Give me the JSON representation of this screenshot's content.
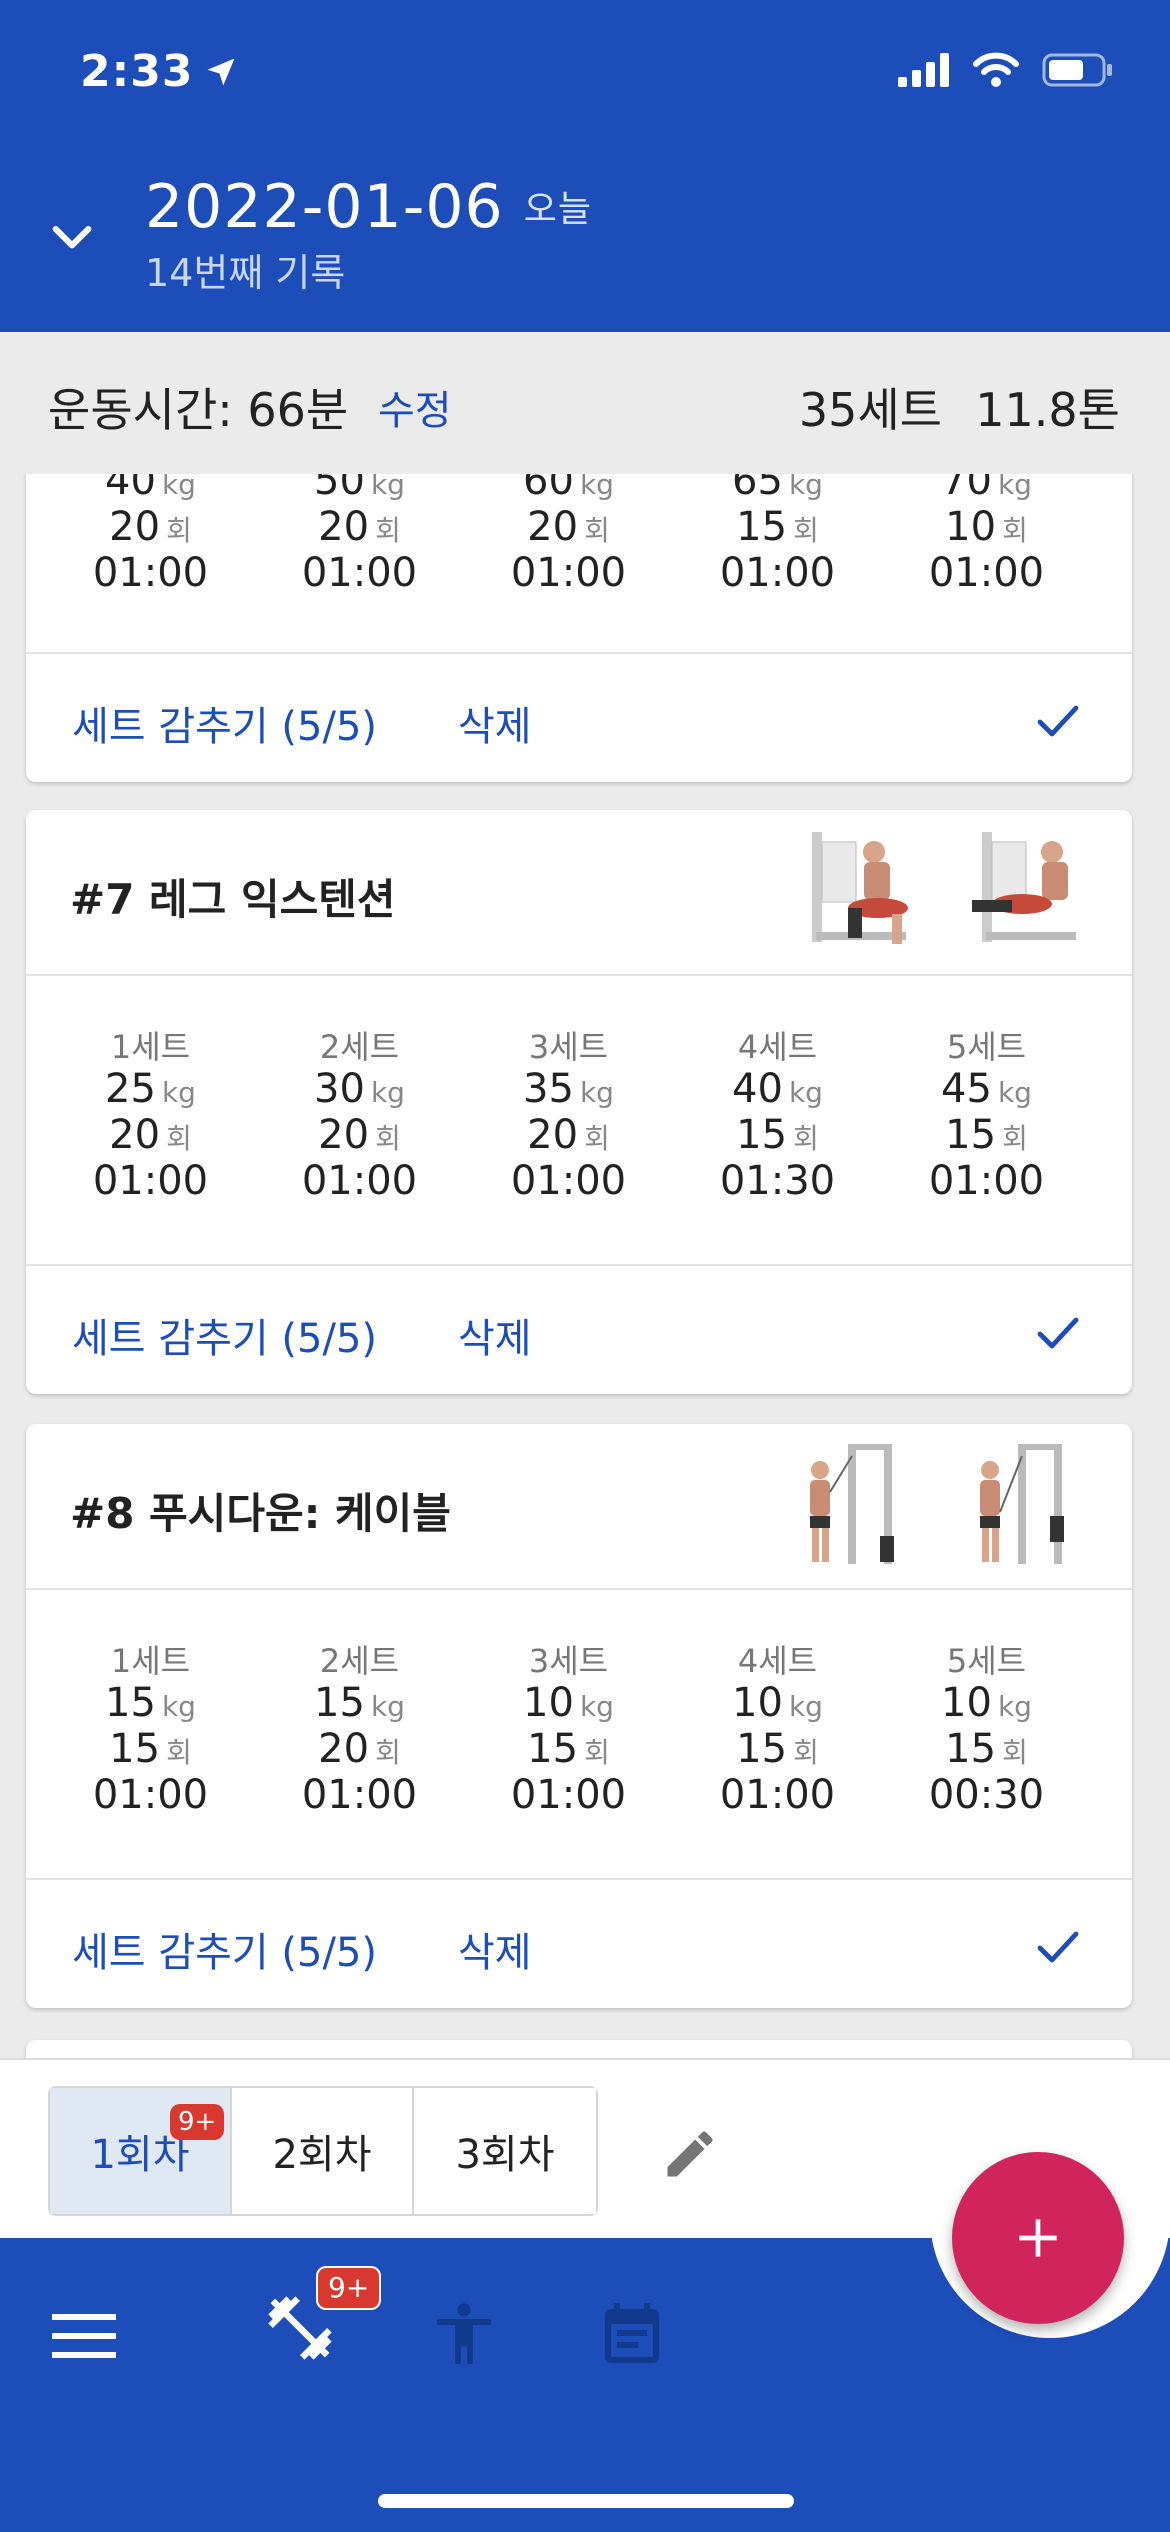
{
  "status_bar": {
    "time": "2:33"
  },
  "header": {
    "date": "2022-01-06",
    "today": "오늘",
    "subtitle": "14번째 기록"
  },
  "summary": {
    "exercise_time": "운동시간: 66분",
    "edit": "수정",
    "total_sets": "35세트",
    "total_weight": "11.8톤"
  },
  "cards": [
    {
      "sets": [
        {
          "weight": "40",
          "reps": "20",
          "time": "01:00"
        },
        {
          "weight": "50",
          "reps": "20",
          "time": "01:00"
        },
        {
          "weight": "60",
          "reps": "20",
          "time": "01:00"
        },
        {
          "weight": "65",
          "reps": "15",
          "time": "01:00"
        },
        {
          "weight": "70",
          "reps": "10",
          "time": "01:00"
        }
      ],
      "hide_label": "세트 감추기 (5/5)",
      "delete_label": "삭제"
    },
    {
      "title": "#7 레그 익스텐션",
      "sets": [
        {
          "label": "1세트",
          "weight": "25",
          "reps": "20",
          "time": "01:00"
        },
        {
          "label": "2세트",
          "weight": "30",
          "reps": "20",
          "time": "01:00"
        },
        {
          "label": "3세트",
          "weight": "35",
          "reps": "20",
          "time": "01:00"
        },
        {
          "label": "4세트",
          "weight": "40",
          "reps": "15",
          "time": "01:30"
        },
        {
          "label": "5세트",
          "weight": "45",
          "reps": "15",
          "time": "01:00"
        }
      ],
      "hide_label": "세트 감추기 (5/5)",
      "delete_label": "삭제"
    },
    {
      "title": "#8 푸시다운: 케이블",
      "sets": [
        {
          "label": "1세트",
          "weight": "15",
          "reps": "15",
          "time": "01:00"
        },
        {
          "label": "2세트",
          "weight": "15",
          "reps": "20",
          "time": "01:00"
        },
        {
          "label": "3세트",
          "weight": "10",
          "reps": "15",
          "time": "01:00"
        },
        {
          "label": "4세트",
          "weight": "10",
          "reps": "15",
          "time": "01:00"
        },
        {
          "label": "5세트",
          "weight": "10",
          "reps": "15",
          "time": "00:30"
        }
      ],
      "hide_label": "세트 감추기 (5/5)",
      "delete_label": "삭제"
    }
  ],
  "units": {
    "weight": "kg",
    "reps": "회"
  },
  "rounds": {
    "tabs": [
      "1회차",
      "2회차",
      "3회차"
    ],
    "badge": "9+"
  },
  "nav": {
    "workout_badge": "9+",
    "icons": [
      "menu-icon",
      "dumbbell-icon",
      "body-icon",
      "calendar-icon"
    ]
  },
  "colors": {
    "primary": "#1d4db8",
    "fab": "#d1235c",
    "badge": "#d9382e"
  }
}
